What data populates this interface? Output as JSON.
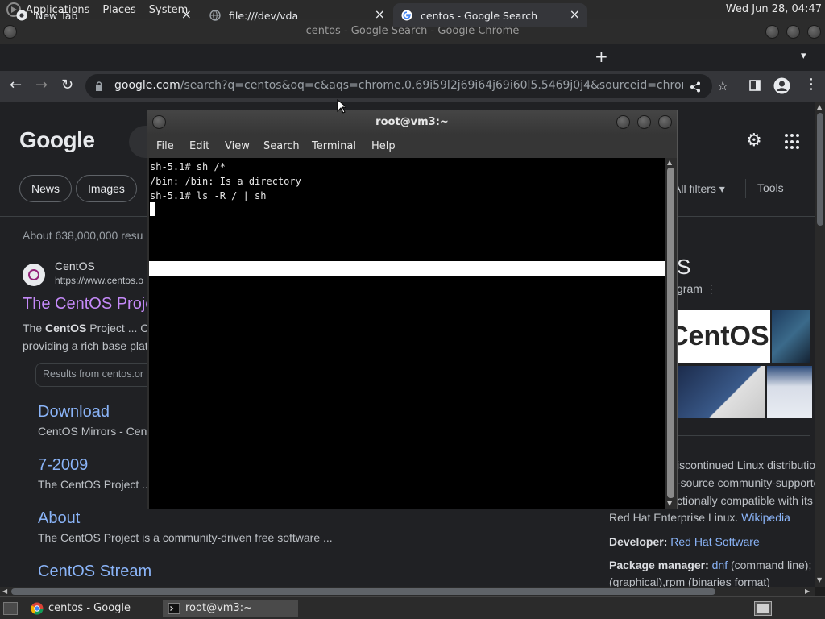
{
  "top_panel": {
    "menus": [
      "Applications",
      "Places",
      "System"
    ],
    "clock": "Wed Jun 28, 04:47"
  },
  "chrome": {
    "window_title": "centos - Google Search - Google Chrome",
    "tabs": [
      {
        "label": "New Tab"
      },
      {
        "label": "file:///dev/vda"
      },
      {
        "label": "centos - Google Search"
      }
    ],
    "url_domain": "google.com",
    "url_rest": "/search?q=centos&oq=c&aqs=chrome.0.69i59l2j69i64j69i60l5.5469j0j4&sourceid=chrome&ie=UTF-8"
  },
  "google": {
    "logo": "Google",
    "chips": [
      "News",
      "Images"
    ],
    "filters": "All filters",
    "tools": "Tools",
    "result_count": "About 638,000,000 resu",
    "site_name": "CentOS",
    "site_url": "https://www.centos.o",
    "result_title": "The CentOS Proje",
    "snippet_line1_prefix": "The ",
    "snippet_line1_bold": "CentOS",
    "snippet_line1_rest": " Project ... Co",
    "snippet_line2": "providing a rich base plat",
    "results_from": "Results from centos.or",
    "sublinks": [
      {
        "title": "Download",
        "desc": "CentOS Mirrors - Cent"
      },
      {
        "title": "7-2009",
        "desc": "The CentOS Project ..."
      },
      {
        "title": "About",
        "desc": "The CentOS Project is a community-driven free software ..."
      },
      {
        "title": "CentOS Stream",
        "desc": ""
      }
    ],
    "knowledge_panel": {
      "title": "S",
      "subtitle": "gram",
      "logo_text": "CentOS",
      "desc_line1": "iscontinued Linux distributio",
      "desc_line2": "-source community-supporte",
      "desc_line3": "ctionally compatible with its",
      "desc_line4_text": "Red Hat Enterprise Linux. ",
      "desc_line4_link": "Wikipedia",
      "developer_label": "Developer: ",
      "developer_value": "Red Hat Software",
      "pkg_label": "Package manager: ",
      "pkg_link": "dnf",
      "pkg_rest": " (command line); P",
      "pkg_line2": "(graphical),rpm (binaries format)"
    }
  },
  "terminal": {
    "title": "root@vm3:~",
    "menu": [
      "File",
      "Edit",
      "View",
      "Search",
      "Terminal",
      "Help"
    ],
    "lines": [
      "sh-5.1# sh /*",
      "/bin: /bin: Is a directory",
      "sh-5.1# ls -R / | sh"
    ]
  },
  "taskbar": {
    "tasks": [
      {
        "label": "centos - Google Sea..."
      },
      {
        "label": "root@vm3:~"
      }
    ]
  }
}
